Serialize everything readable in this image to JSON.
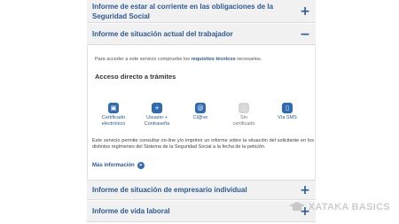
{
  "accordion": {
    "item1_title": "Informe de estar al corriente en las obligaciones de la Seguridad Social",
    "item1_icon": "+",
    "item2_title": "Informe de situación actual del trabajador",
    "item2_icon": "−",
    "item3_title": "Informe de situación de empresario individual",
    "item3_icon": "+",
    "item4_title": "Informe de vida laboral",
    "item4_icon": "+"
  },
  "content": {
    "intro_prefix": "Para acceder a este servicio compruebe los",
    "intro_link": "requisitos técnicos",
    "intro_suffix": "necesarios.",
    "access_heading": "Acceso directo a trámites",
    "options": [
      {
        "label_line1": "Certificado",
        "label_line2": "electrónico",
        "icon": "certificate-icon"
      },
      {
        "label_line1": "Usuario +",
        "label_line2": "Contraseña",
        "icon": "user-password-icon"
      },
      {
        "label_line1": "Cl@ve",
        "label_line2": "",
        "icon": "clave-icon"
      },
      {
        "label_line1": "Sin",
        "label_line2": "certificado",
        "icon": "no-certificate-icon"
      },
      {
        "label_line1": "Vía SMS",
        "label_line2": "",
        "icon": "sms-icon"
      }
    ],
    "description": "Este servicio permite consultar on-line y/o imprimir un informe sobre la situación del solicitante en los distintos regímenes del Sistema de la Seguridad Social a la fecha de la petición.",
    "more_info": "Más información",
    "more_icon": "»"
  },
  "watermark": {
    "text": "XATAKA BASICS",
    "color": "#c8c8c8"
  },
  "colors": {
    "accent": "#2a5a93",
    "header_bg": "#f1f1f1"
  }
}
